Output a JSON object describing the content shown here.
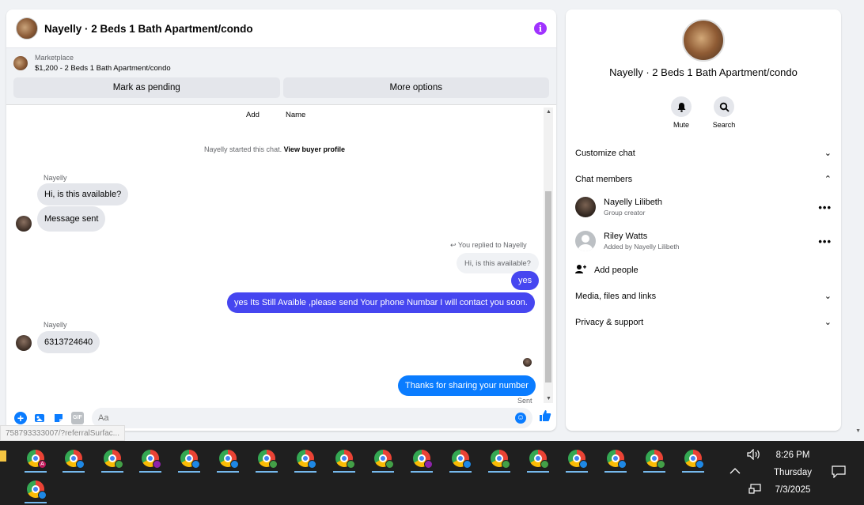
{
  "chat": {
    "title": "Nayelly · 2 Beds 1 Bath Apartment/condo",
    "marketplace_label": "Marketplace",
    "listing": "$1,200 - 2 Beds 1 Bath Apartment/condo",
    "buttons": {
      "pending": "Mark as pending",
      "more": "More options"
    },
    "top_labels": {
      "add": "Add",
      "name": "Name"
    },
    "system": {
      "text": "Nayelly started this chat.",
      "link": "View buyer profile"
    },
    "messages": {
      "sender1": "Nayelly",
      "m1": "Hi, is this available?",
      "m2": "Message sent",
      "reply_note": "You replied to Nayelly",
      "reply_quote": "Hi, is this available?",
      "m3": "yes",
      "m4": "yes Its Still Avaible ,please send Your phone Numbar I will contact you soon.",
      "sender2": "Nayelly",
      "m5": "6313724640",
      "m6": "Thanks for sharing your number",
      "sent": "Sent"
    },
    "composer_placeholder": "Aa",
    "composer_icons": [
      "plus-icon",
      "image-icon",
      "sticker-icon",
      "gif-icon",
      "emoji-icon",
      "like-icon"
    ],
    "gif_text": "GIF"
  },
  "info": {
    "title": "Nayelly · 2 Beds 1 Bath Apartment/condo",
    "actions": {
      "mute": "Mute",
      "search": "Search"
    },
    "sections": {
      "customize": "Customize chat",
      "members": "Chat members",
      "media": "Media, files and links",
      "privacy": "Privacy & support"
    },
    "members": [
      {
        "name": "Nayelly Lilibeth",
        "sub": "Group creator"
      },
      {
        "name": "Riley Watts",
        "sub": "Added by Nayelly Lilibeth"
      }
    ],
    "add_people": "Add people"
  },
  "status_url": "758793333007/?referralSurfac...",
  "taskbar": {
    "time": "8:26 PM",
    "day": "Thursday",
    "date": "7/3/2025",
    "badge_letter": "A",
    "badge_colors": [
      "#c2185b",
      "#1e88e5",
      "#43a047",
      "#8e24aa",
      "#1e88e5",
      "#1e88e5",
      "#43a047",
      "#1e88e5",
      "#43a047",
      "#43a047",
      "#8e24aa",
      "#1e88e5",
      "#43a047",
      "#43a047",
      "#1e88e5",
      "#1e88e5",
      "#43a047",
      "#1e88e5"
    ]
  },
  "colors": {
    "accent_blue": "#0a7cff",
    "accent_purple": "#4646f0",
    "info_purple": "#a033ff"
  }
}
